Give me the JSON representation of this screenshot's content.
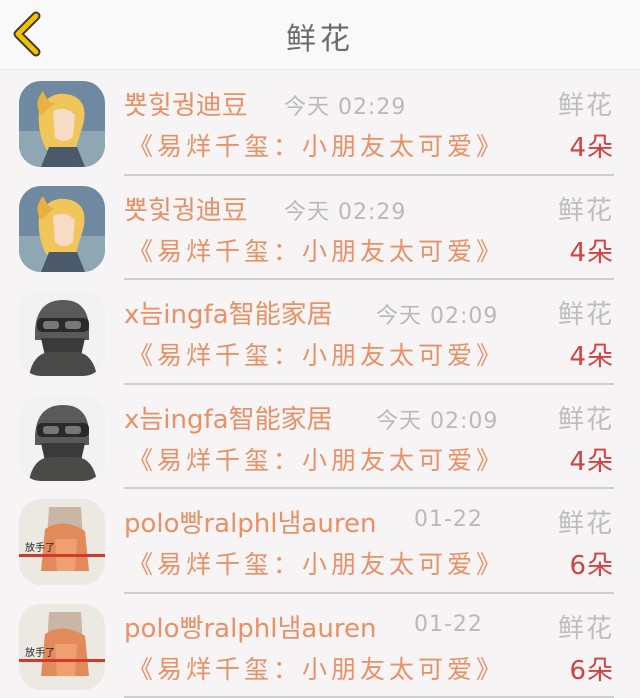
{
  "header": {
    "title": "鲜花",
    "back_icon": "chevron-left-icon",
    "accent": "#f2c200"
  },
  "colors": {
    "name": "#e89167",
    "time": "#b9b9b9",
    "count": "#d24242",
    "label": "#bdbdbd"
  },
  "records": [
    {
      "name": "뿃힟궝迪豆",
      "time": "今天 02:29",
      "label": "鲜花",
      "book": "《易烊千玺：小朋友太可爱》",
      "count": "4朵",
      "avatar": "anime-character-avatar"
    },
    {
      "name": "뿃힟궝迪豆",
      "time": "今天 02:29",
      "label": "鲜花",
      "book": "《易烊千玺：小朋友太可爱》",
      "count": "4朵",
      "avatar": "anime-character-avatar"
    },
    {
      "name": "x늠ingfa智能家居",
      "time": "今天 02:09",
      "label": "鲜花",
      "book": "《易烊千玺：小朋友太可爱》",
      "count": "4朵",
      "avatar": "masked-soldier-avatar"
    },
    {
      "name": "x늠ingfa智能家居",
      "time": "今天 02:09",
      "label": "鲜花",
      "book": "《易烊千玺：小朋友太可爱》",
      "count": "4朵",
      "avatar": "masked-soldier-avatar"
    },
    {
      "name": "polo빵ralphl냄auren",
      "time": "01-22",
      "label": "鲜花",
      "book": "《易烊千玺：小朋友太可爱》",
      "count": "6朵",
      "avatar": "sketch-girl-avatar"
    },
    {
      "name": "polo빵ralphl냄auren",
      "time": "01-22",
      "label": "鲜花",
      "book": "《易烊千玺：小朋友太可爱》",
      "count": "6朵",
      "avatar": "sketch-girl-avatar"
    }
  ],
  "avatar_caption": "放手了"
}
